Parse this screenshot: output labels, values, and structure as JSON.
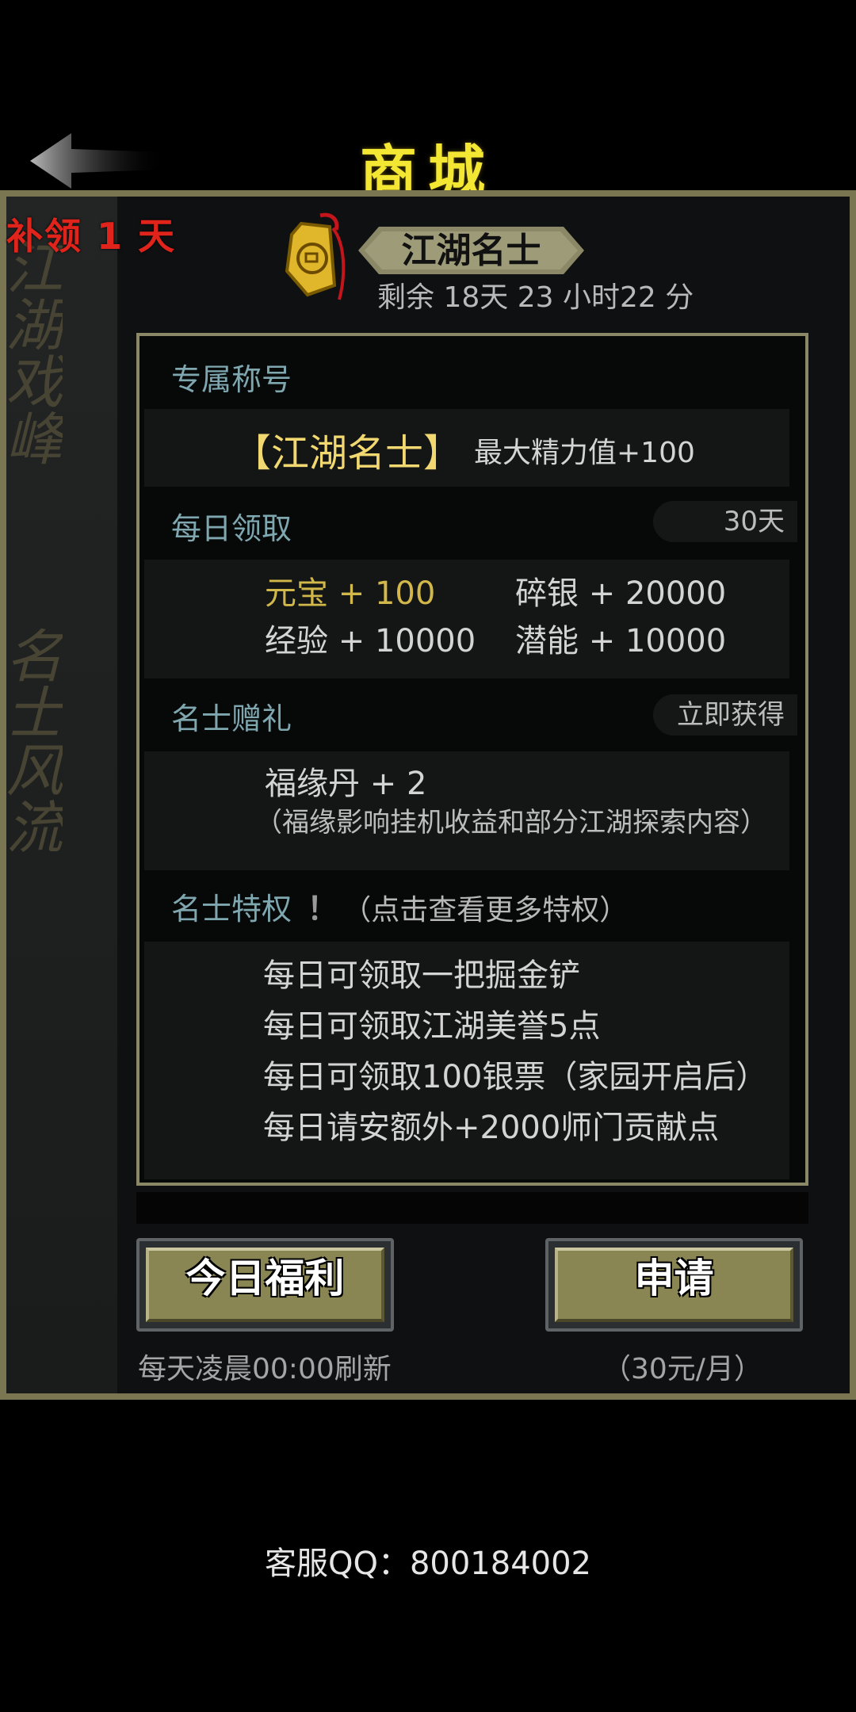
{
  "header": {
    "title": "商城",
    "back_icon": "back-arrow-icon"
  },
  "side": {
    "makeup_badge": "补领 1 天",
    "calligraphy_top": "江湖戏峰",
    "calligraphy_bottom": "名士风流"
  },
  "vip": {
    "name": "江湖名士",
    "remaining": "剩余 18天 23 小时22 分",
    "tag_icon": "jade-tag-icon"
  },
  "sections": {
    "title": {
      "heading": "专属称号",
      "name": "【江湖名士】",
      "bonus": "最大精力值+100"
    },
    "daily": {
      "heading": "每日领取",
      "days": "30天",
      "rewards": [
        "元宝 + 100",
        "碎银 + 20000",
        "经验 + 10000",
        "潜能 + 10000"
      ]
    },
    "gift": {
      "heading": "名士赠礼",
      "action": "立即获得",
      "item": "福缘丹 + 2",
      "note": "（福缘影响挂机收益和部分江湖探索内容）"
    },
    "privilege": {
      "heading": "名士特权",
      "hint_mark": "！",
      "hint": "（点击查看更多特权）",
      "items": [
        "每日可领取一把掘金铲",
        "每日可领取江湖美誉5点",
        "每日可领取100银票（家园开启后）",
        "每日请安额外+2000师门贡献点"
      ]
    }
  },
  "buttons": {
    "daily_welfare": "今日福利",
    "daily_note": "每天凌晨00:00刷新",
    "apply": "申请",
    "apply_note": "（30元/月）"
  },
  "footer": {
    "support": "客服QQ：800184002"
  },
  "colors": {
    "title_yellow": "#f4e733",
    "frame_olive": "#7a7651",
    "button_olive": "#8a8654",
    "badge_red": "#e0241c",
    "section_teal": "#7fa7b0",
    "gold_text": "#d2b84a"
  }
}
